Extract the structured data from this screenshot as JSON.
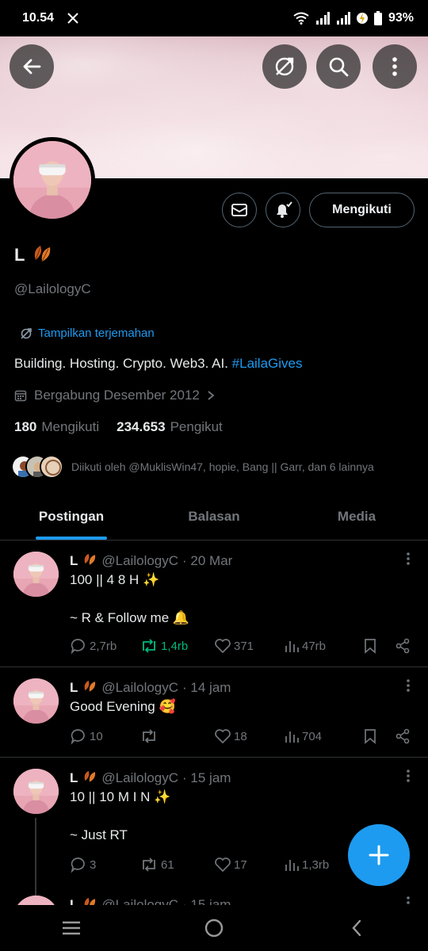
{
  "status_bar": {
    "time": "10.54",
    "battery": "93%"
  },
  "profile": {
    "name": "L",
    "handle": "@LailologyC",
    "translate_label": "Tampilkan terjemahan",
    "bio_text": "Building. Hosting. Crypto. Web3. AI. ",
    "bio_hashtag": "#LailaGives",
    "joined": "Bergabung Desember 2012",
    "following_count": "180",
    "following_label": "Mengikuti",
    "followers_count": "234.653",
    "followers_label": "Pengikut",
    "followed_by": "Diikuti oleh @MuklisWin47, hopie, Bang || Garr, dan 6 lainnya",
    "follow_button": "Mengikuti"
  },
  "tabs": [
    {
      "label": "Postingan",
      "active": true
    },
    {
      "label": "Balasan",
      "active": false
    },
    {
      "label": "Media",
      "active": false
    }
  ],
  "posts": [
    {
      "name": "L",
      "handle": "@LailologyC",
      "time": "· 20 Mar",
      "text": "100 || 4 8 H ✨\n\n~ R & Follow me 🔔",
      "replies": "2,7rb",
      "reposts": "1,4rb",
      "reposted": true,
      "likes": "371",
      "views": "47rb"
    },
    {
      "name": "L",
      "handle": "@LailologyC",
      "time": "· 14 jam",
      "text": "Good Evening 🥰",
      "replies": "10",
      "reposts": "",
      "reposted": false,
      "likes": "18",
      "views": "704"
    },
    {
      "name": "L",
      "handle": "@LailologyC",
      "time": "· 15 jam",
      "text": "10 || 10 M I N ✨\n\n~ Just RT",
      "replies": "3",
      "reposts": "61",
      "reposted": false,
      "likes": "17",
      "views": "1,3rb"
    },
    {
      "name": "L",
      "handle": "@LailologyC",
      "time": "· 15 jam"
    }
  ],
  "colors": {
    "accent": "#1d9bf0",
    "repost_active": "#00ba7c",
    "muted": "#71767b",
    "divider": "#2f3336"
  }
}
